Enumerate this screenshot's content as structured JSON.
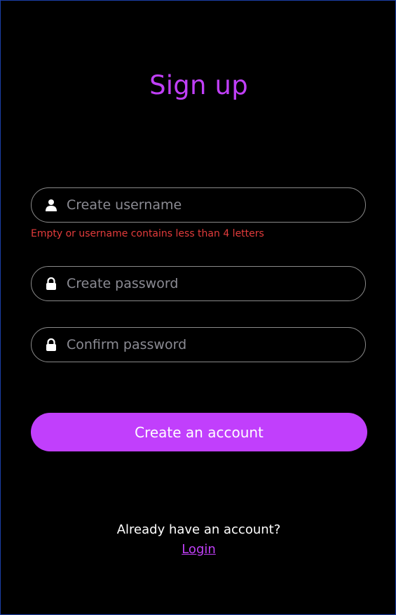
{
  "page": {
    "title": "Sign up"
  },
  "form": {
    "username": {
      "placeholder": "Create username",
      "value": "",
      "icon": "user-icon",
      "error": "Empty or username contains less than 4 letters"
    },
    "password": {
      "placeholder": "Create password",
      "value": "",
      "icon": "lock-icon"
    },
    "confirm_password": {
      "placeholder": "Confirm password",
      "value": "",
      "icon": "lock-icon"
    },
    "submit_label": "Create an account"
  },
  "footer": {
    "prompt": "Already have an account?",
    "login_label": "Login"
  },
  "colors": {
    "background": "#000000",
    "accent": "#c03ff7",
    "error": "#e23b3b",
    "border": "#8a8a8a",
    "placeholder": "#8b8b93"
  }
}
